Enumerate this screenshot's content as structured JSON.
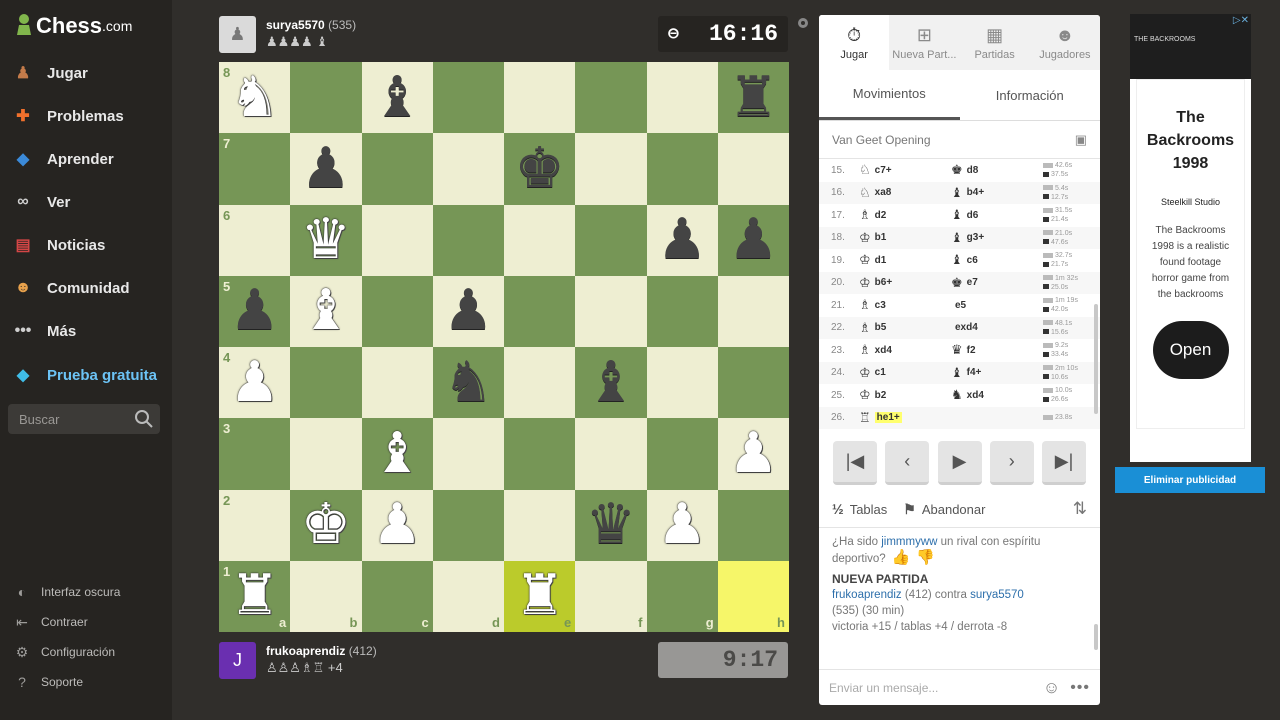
{
  "site": {
    "logo_main": "Chess",
    "logo_suffix": ".com"
  },
  "nav": [
    {
      "label": "Jugar",
      "icon": "play-icon",
      "glyph": "♟",
      "color": "#c47b4a"
    },
    {
      "label": "Problemas",
      "icon": "puzzle-icon",
      "glyph": "✚",
      "color": "#f0702c"
    },
    {
      "label": "Aprender",
      "icon": "learn-icon",
      "glyph": "◆",
      "color": "#3b8ad9"
    },
    {
      "label": "Ver",
      "icon": "binoculars-icon",
      "glyph": "∞",
      "color": "#cfcfcf"
    },
    {
      "label": "Noticias",
      "icon": "news-icon",
      "glyph": "▤",
      "color": "#d44646"
    },
    {
      "label": "Comunidad",
      "icon": "community-icon",
      "glyph": "☻",
      "color": "#e7a14c"
    },
    {
      "label": "Más",
      "icon": "more-icon",
      "glyph": "•••",
      "color": "#cfcfcf"
    },
    {
      "label": "Prueba gratuita",
      "icon": "diamond-icon",
      "glyph": "◆",
      "color": "#3fbde8"
    }
  ],
  "search": {
    "placeholder": "Buscar"
  },
  "bottom_nav": [
    {
      "label": "Interfaz oscura",
      "glyph": "◐"
    },
    {
      "label": "Contraer",
      "glyph": "⇤"
    },
    {
      "label": "Configuración",
      "glyph": "⚙"
    },
    {
      "label": "Soporte",
      "glyph": "?"
    }
  ],
  "top_player": {
    "name": "surya5570",
    "rating": "(535)",
    "captured": "♟♟♟♟ ♝",
    "clock": "16:16"
  },
  "bottom_player": {
    "name": "frukoaprendiz",
    "rating": "(412)",
    "initial": "J",
    "captured": "♙♙♙♗♖",
    "material": "+4",
    "clock": "9:17"
  },
  "board": {
    "ranks": [
      "8",
      "7",
      "6",
      "5",
      "4",
      "3",
      "2",
      "1"
    ],
    "files": [
      "a",
      "b",
      "c",
      "d",
      "e",
      "f",
      "g",
      "h"
    ],
    "rows": [
      [
        "wN",
        "",
        "bB",
        "",
        "",
        "",
        "",
        "bR"
      ],
      [
        "",
        "bP",
        "",
        "",
        "bK",
        "",
        "",
        ""
      ],
      [
        "",
        "wQ",
        "",
        "",
        "",
        "",
        "bP",
        "bP"
      ],
      [
        "bP",
        "wB",
        "",
        "bP",
        "",
        "",
        "",
        ""
      ],
      [
        "wP",
        "",
        "",
        "bN",
        "",
        "bB",
        "",
        ""
      ],
      [
        "",
        "",
        "wB",
        "",
        "",
        "",
        "",
        "wP"
      ],
      [
        "",
        "wK",
        "wP",
        "",
        "",
        "bQ",
        "wP",
        ""
      ],
      [
        "wR",
        "",
        "",
        "",
        "wR",
        "",
        "",
        ""
      ]
    ],
    "highlight": [
      "7-4",
      "7-7"
    ]
  },
  "panel": {
    "tabs": [
      {
        "label": "Jugar",
        "glyph": "⏱"
      },
      {
        "label": "Nueva Part...",
        "glyph": "⊞"
      },
      {
        "label": "Partidas",
        "glyph": "▦"
      },
      {
        "label": "Jugadores",
        "glyph": "☻"
      }
    ],
    "subtabs": [
      "Movimientos",
      "Información"
    ],
    "opening": "Van Geet Opening",
    "moves": [
      {
        "n": "15.",
        "wp": "♘",
        "w": "c7+",
        "bp": "♚",
        "b": "d8",
        "t1": "42.6s",
        "t2": "37.5s"
      },
      {
        "n": "16.",
        "wp": "♘",
        "w": "xa8",
        "bp": "♝",
        "b": "b4+",
        "t1": "5.4s",
        "t2": "12.7s"
      },
      {
        "n": "17.",
        "wp": "♗",
        "w": "d2",
        "bp": "♝",
        "b": "d6",
        "t1": "31.5s",
        "t2": "21.4s"
      },
      {
        "n": "18.",
        "wp": "♔",
        "w": "b1",
        "bp": "♝",
        "b": "g3+",
        "t1": "21.0s",
        "t2": "47.6s"
      },
      {
        "n": "19.",
        "wp": "♔",
        "w": "d1",
        "bp": "♝",
        "b": "c6",
        "t1": "32.7s",
        "t2": "21.7s"
      },
      {
        "n": "20.",
        "wp": "♔",
        "w": "b6+",
        "bp": "♚",
        "b": "e7",
        "t1": "1m 32s",
        "t2": "25.0s"
      },
      {
        "n": "21.",
        "wp": "♗",
        "w": "c3",
        "bp": "",
        "b": "e5",
        "t1": "1m 19s",
        "t2": "42.0s"
      },
      {
        "n": "22.",
        "wp": "♗",
        "w": "b5",
        "bp": "",
        "b": "exd4",
        "t1": "48.1s",
        "t2": "15.6s"
      },
      {
        "n": "23.",
        "wp": "♗",
        "w": "xd4",
        "bp": "♛",
        "b": "f2",
        "t1": "9.2s",
        "t2": "33.4s"
      },
      {
        "n": "24.",
        "wp": "♔",
        "w": "c1",
        "bp": "♝",
        "b": "f4+",
        "t1": "2m 10s",
        "t2": "10.6s"
      },
      {
        "n": "25.",
        "wp": "♔",
        "w": "b2",
        "bp": "♞",
        "b": "xd4",
        "t1": "10.0s",
        "t2": "26.6s"
      },
      {
        "n": "26.",
        "wp": "♖",
        "w": "he1+",
        "bp": "",
        "b": "",
        "t1": "23.8s",
        "t2": ""
      }
    ],
    "draw": "Tablas",
    "draw_prefix": "½",
    "resign": "Abandonar",
    "chat": {
      "q1": "¿Ha sido ",
      "rival": "jimmmyww",
      "q2": " un rival con espíritu deportivo?",
      "new_game": "NUEVA PARTIDA",
      "p1": "frukoaprendiz",
      "p1_rating": " (412) contra ",
      "p2": "surya5570",
      "p2_info": "(535) (30 min)",
      "score": "victoria +15 / tablas +4 / derrota -8"
    },
    "message_placeholder": "Enviar un mensaje..."
  },
  "ad": {
    "banner_text": "THE BACKROOMS",
    "title": "The Backrooms 1998",
    "studio": "Steelkill Studio",
    "desc": "The Backrooms 1998 is a realistic found footage horror game from the backrooms",
    "button": "Open",
    "remove": "Eliminar publicidad"
  }
}
